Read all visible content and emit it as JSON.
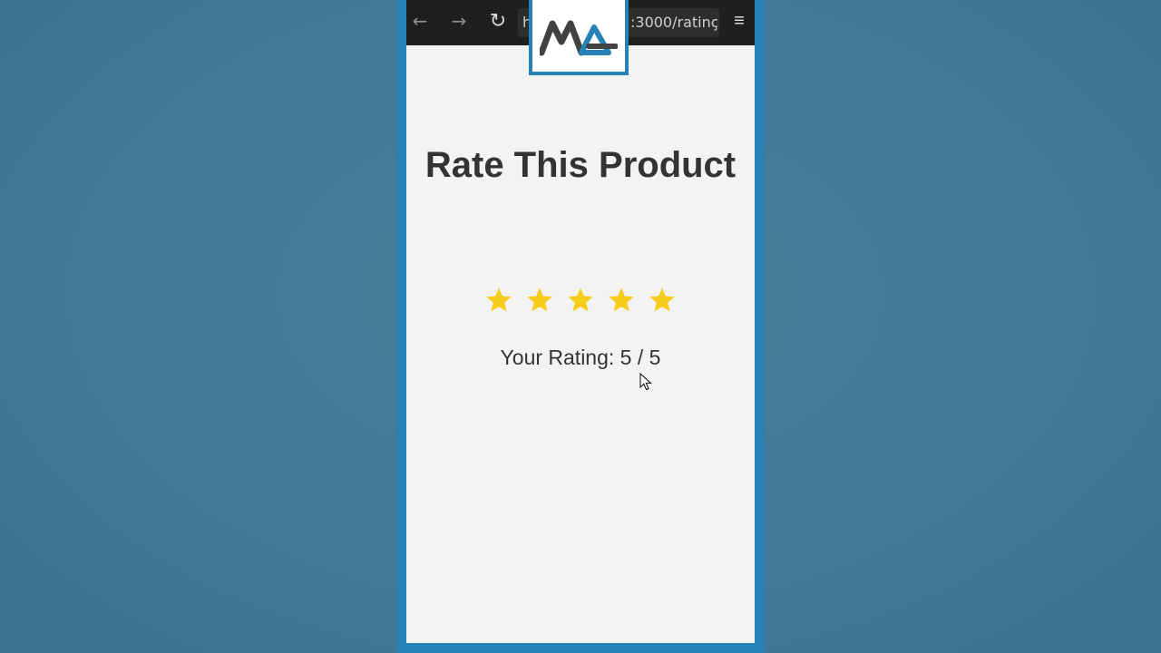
{
  "browser": {
    "back_icon": "arrow-left-icon",
    "forward_icon": "arrow-right-icon",
    "reload_icon": "reload-icon",
    "url_prefix": "h",
    "url_visible": ":3000/ratinç",
    "menu_icon": "hamburger-menu-icon"
  },
  "logo": {
    "text": "MA",
    "colors": {
      "primary": "#424242",
      "accent": "#2581b6"
    }
  },
  "page": {
    "title": "Rate This Product",
    "rating_label": "Your Rating: 5 / 5",
    "rating_value": 5,
    "rating_max": 5,
    "star_color": "#f7cc1a"
  },
  "colors": {
    "frame": "#2581b6",
    "background": "#43799a",
    "page_bg": "#f3f3f3",
    "text": "#333333",
    "toolbar": "#1f1f1f"
  }
}
